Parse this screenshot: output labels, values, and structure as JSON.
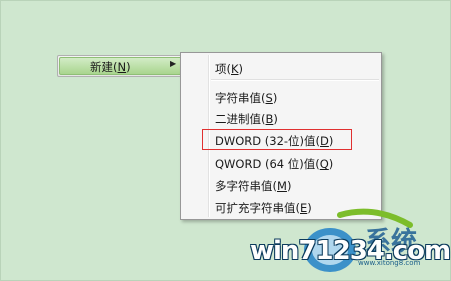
{
  "context_menu": {
    "new_label": "新建(N)",
    "new_label_plain": "新建(",
    "new_label_key": "N",
    "new_label_end": ")",
    "arrow": "▶"
  },
  "submenu": {
    "items": [
      {
        "before": "项(",
        "key": "K",
        "after": ")"
      },
      {
        "before": "字符串值(",
        "key": "S",
        "after": ")"
      },
      {
        "before": "二进制值(",
        "key": "B",
        "after": ")"
      },
      {
        "before": "DWORD (32-位)值(",
        "key": "D",
        "after": ")"
      },
      {
        "before": "QWORD (64 位)值(",
        "key": "Q",
        "after": ")"
      },
      {
        "before": "多字符串值(",
        "key": "M",
        "after": ")"
      },
      {
        "before": "可扩充字符串值(",
        "key": "E",
        "after": ")"
      }
    ]
  },
  "branding": {
    "logo_text": "win71234.com",
    "watermark": "www.xitong8.com"
  },
  "colors": {
    "desktop": "#cfe7cf",
    "highlight_border": "#e03030"
  }
}
